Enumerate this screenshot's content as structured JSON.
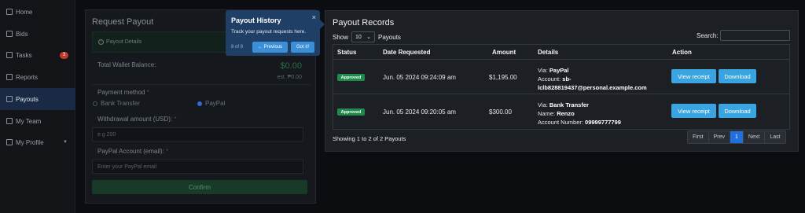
{
  "sidebar": {
    "items": [
      {
        "label": "Home",
        "icon": "home-icon"
      },
      {
        "label": "Bids",
        "icon": "bids-icon"
      },
      {
        "label": "Tasks",
        "icon": "tasks-icon",
        "badge": "3"
      },
      {
        "label": "Reports",
        "icon": "reports-icon"
      },
      {
        "label": "Payouts",
        "icon": "payouts-icon",
        "active": true
      },
      {
        "label": "My Team",
        "icon": "team-icon"
      },
      {
        "label": "My Profile",
        "icon": "profile-icon",
        "caret": "▼"
      }
    ]
  },
  "request_payout": {
    "title": "Request Payout",
    "details_label": "Payout Details",
    "wallet_label": "Total Wallet Balance:",
    "wallet_amount": "$0.00",
    "wallet_est": "est. ₱0.00",
    "method_label": "Payment method",
    "required_mark": "*",
    "method_bank": "Bank Transfer",
    "method_paypal": "PayPal",
    "withdraw_label": "Withdrawal amount (USD):",
    "withdraw_placeholder": "e.g 200",
    "paypal_label": "PayPal Account (email):",
    "paypal_placeholder": "Enter your PayPal email",
    "confirm_label": "Confirm"
  },
  "tour": {
    "title": "Payout History",
    "close": "×",
    "body": "Track your payout requests here.",
    "step": "8 of 8",
    "prev_label": "← Previous",
    "gotit_label": "Got it!"
  },
  "records": {
    "title": "Payout Records",
    "show_label": "Show",
    "show_value": "10",
    "show_suffix": "Payouts",
    "search_label": "Search:",
    "columns": [
      "Status",
      "Date Requested",
      "Amount",
      "Details",
      "Action"
    ],
    "rows": [
      {
        "status": "Approved",
        "date": "Jun. 05 2024 09:24:09 am",
        "amount": "$1,195.00",
        "details": {
          "via_label": "Via:",
          "via_value": "PayPal",
          "account_label": "Account:",
          "account_value_1": "sb-",
          "account_value_2": "lclb828819437@personal.example.com"
        },
        "receipt_label": "View receipt",
        "download_label": "Download"
      },
      {
        "status": "Approved",
        "date": "Jun. 05 2024 09:20:05 am",
        "amount": "$300.00",
        "details": {
          "via_label": "Via:",
          "via_value": "Bank Transfer",
          "name_label": "Name:",
          "name_value": "Renzo",
          "accno_label": "Account Number:",
          "accno_value": "09999777799"
        },
        "receipt_label": "View receipt",
        "download_label": "Download"
      }
    ],
    "showing": "Showing 1 to 2 of 2 Payouts",
    "pager": [
      "First",
      "Prev",
      "1",
      "Next",
      "Last"
    ]
  },
  "colors": {
    "accent": "#1f6fe0",
    "approved": "#1f8a4c",
    "action_button": "#3aa4e0",
    "tour_bg": "#1f3f66"
  }
}
